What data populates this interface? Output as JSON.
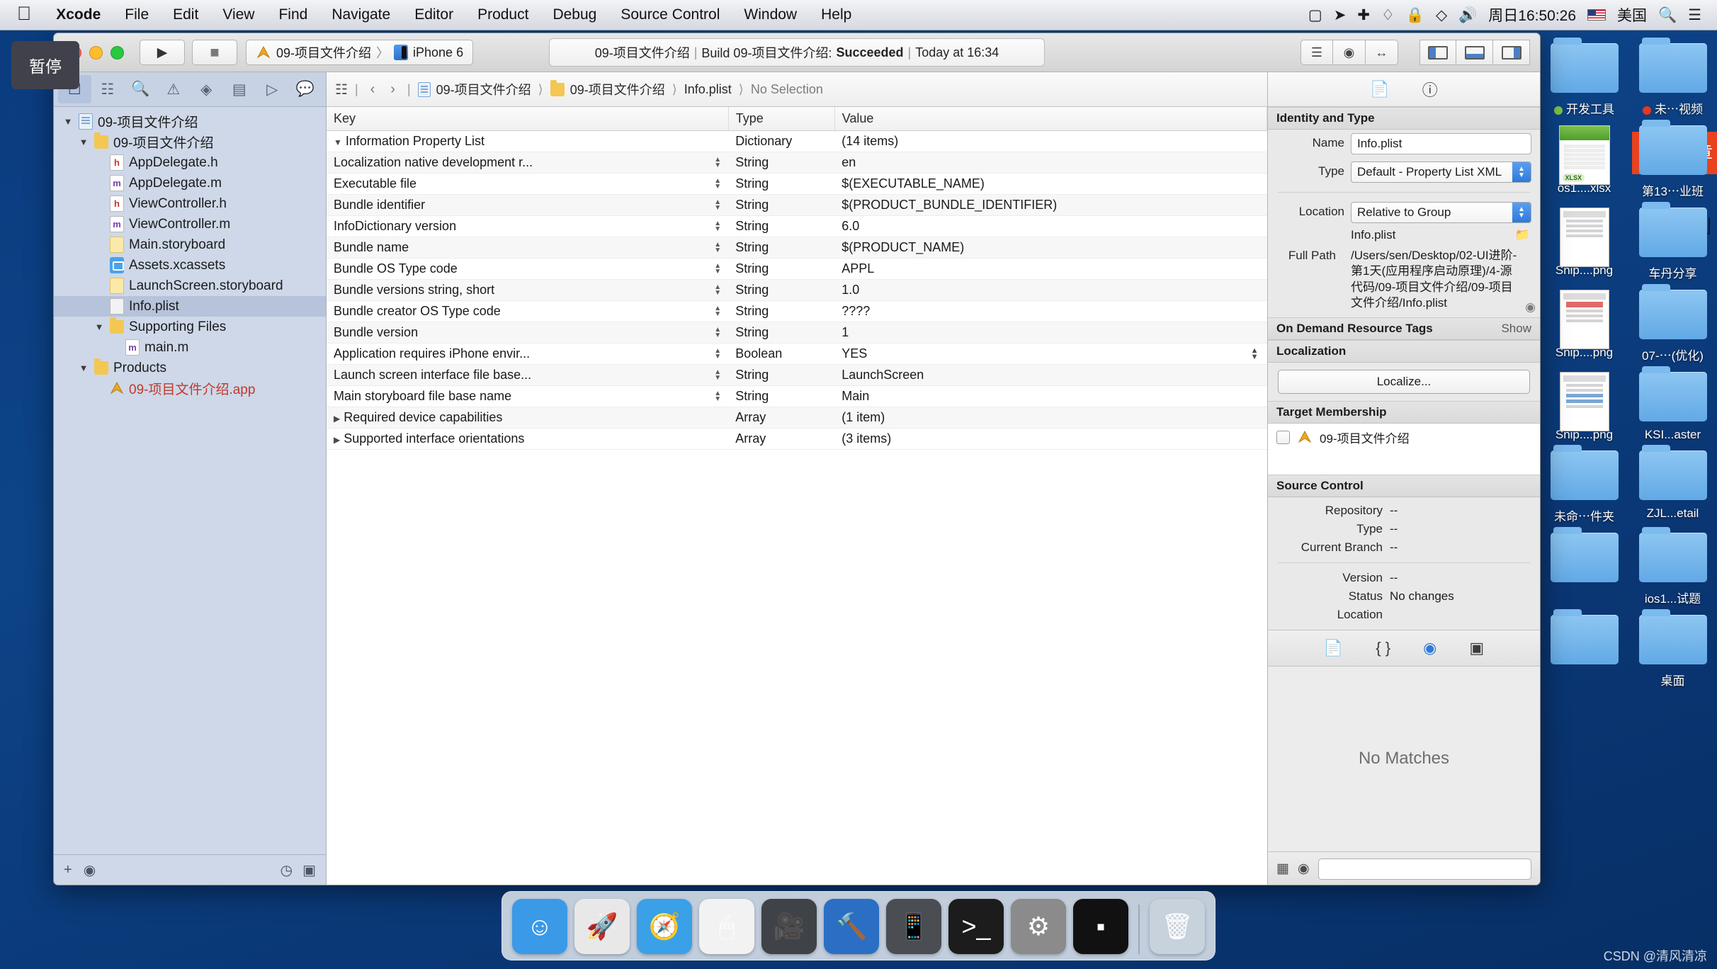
{
  "menubar": {
    "apple_icon": "apple-icon",
    "items": [
      "Xcode",
      "File",
      "Edit",
      "View",
      "Find",
      "Navigate",
      "Editor",
      "Product",
      "Debug",
      "Source Control",
      "Window",
      "Help"
    ],
    "status_icons": [
      "screen-record-icon",
      "location-arrow-icon",
      "airplay-icon",
      "bluetooth-icon",
      "lock-icon",
      "dropbox-icon",
      "volume-icon"
    ],
    "clock": "周日16:50:26",
    "input_source": "美国",
    "search_icon": "search-icon",
    "control_center_icon": "list-icon"
  },
  "tooltip": {
    "label": "暂停"
  },
  "toolbar": {
    "run_icon": "play-icon",
    "stop_icon": "stop-icon",
    "scheme_project": "09-项目文件介绍",
    "scheme_separator": "〉",
    "scheme_device": "iPhone 6",
    "status": {
      "project": "09-项目文件介绍",
      "sep1": "|",
      "build_label": "Build 09-项目文件介绍:",
      "result": "Succeeded",
      "sep2": "|",
      "time": "Today at 16:34"
    },
    "editor_segments": [
      "standard-editor-icon",
      "assistant-editor-icon",
      "version-editor-icon"
    ],
    "panel_toggles": [
      "navigator-toggle-icon",
      "debug-area-toggle-icon",
      "utilities-toggle-icon"
    ]
  },
  "navigator": {
    "tabs": [
      "folder-icon",
      "source-control-icon",
      "search-icon",
      "warning-icon",
      "breakpoint-icon",
      "test-icon",
      "debug-icon",
      "report-icon"
    ],
    "tree": [
      {
        "label": "09-项目文件介绍",
        "icon": "project-icon",
        "indent": 0,
        "twisty": "▼",
        "selected": false,
        "color": "#1b1b1b"
      },
      {
        "label": "09-项目文件介绍",
        "icon": "folder-icon",
        "indent": 1,
        "twisty": "▼",
        "selected": false,
        "color": "#1b1b1b"
      },
      {
        "label": "AppDelegate.h",
        "icon": "header-file-icon",
        "indent": 2,
        "twisty": "",
        "selected": false,
        "color": "#1b1b1b"
      },
      {
        "label": "AppDelegate.m",
        "icon": "source-file-icon",
        "indent": 2,
        "twisty": "",
        "selected": false,
        "color": "#1b1b1b"
      },
      {
        "label": "ViewController.h",
        "icon": "header-file-icon",
        "indent": 2,
        "twisty": "",
        "selected": false,
        "color": "#1b1b1b"
      },
      {
        "label": "ViewController.m",
        "icon": "source-file-icon",
        "indent": 2,
        "twisty": "",
        "selected": false,
        "color": "#1b1b1b"
      },
      {
        "label": "Main.storyboard",
        "icon": "storyboard-icon",
        "indent": 2,
        "twisty": "",
        "selected": false,
        "color": "#1b1b1b"
      },
      {
        "label": "Assets.xcassets",
        "icon": "assets-icon",
        "indent": 2,
        "twisty": "",
        "selected": false,
        "color": "#1b1b1b"
      },
      {
        "label": "LaunchScreen.storyboard",
        "icon": "storyboard-icon",
        "indent": 2,
        "twisty": "",
        "selected": false,
        "color": "#1b1b1b"
      },
      {
        "label": "Info.plist",
        "icon": "plist-icon",
        "indent": 2,
        "twisty": "",
        "selected": true,
        "color": "#1b1b1b"
      },
      {
        "label": "Supporting Files",
        "icon": "folder-icon",
        "indent": 2,
        "twisty": "▼",
        "selected": false,
        "color": "#1b1b1b"
      },
      {
        "label": "main.m",
        "icon": "source-file-icon",
        "indent": 3,
        "twisty": "",
        "selected": false,
        "color": "#1b1b1b"
      },
      {
        "label": "Products",
        "icon": "folder-icon",
        "indent": 1,
        "twisty": "▼",
        "selected": false,
        "color": "#1b1b1b"
      },
      {
        "label": "09-项目文件介绍.app",
        "icon": "app-product-icon",
        "indent": 2,
        "twisty": "",
        "selected": false,
        "color": "#c0392b"
      }
    ],
    "footer": {
      "add_icon": "plus-icon",
      "filter_icon": "filter-icon",
      "recent_icon": "clock-icon",
      "unsaved_icon": "source-control-icon"
    }
  },
  "jumpbar": {
    "grid_icon": "related-items-icon",
    "back_icon": "chevron-left-icon",
    "forward_icon": "chevron-right-icon",
    "crumbs": [
      "09-项目文件介绍",
      "09-项目文件介绍",
      "Info.plist"
    ],
    "selection": "No Selection"
  },
  "plist": {
    "columns": [
      "Key",
      "Type",
      "Value"
    ],
    "rows": [
      {
        "key": "Information Property List",
        "type": "Dictionary",
        "value": "(14 items)",
        "indent": 0,
        "twisty": "▼",
        "stepper": false,
        "dim_value": true
      },
      {
        "key": "Localization native development r...",
        "type": "String",
        "value": "en",
        "indent": 1,
        "twisty": "",
        "stepper": true,
        "dim_value": false
      },
      {
        "key": "Executable file",
        "type": "String",
        "value": "$(EXECUTABLE_NAME)",
        "indent": 1,
        "twisty": "",
        "stepper": true,
        "dim_value": false
      },
      {
        "key": "Bundle identifier",
        "type": "String",
        "value": "$(PRODUCT_BUNDLE_IDENTIFIER)",
        "indent": 1,
        "twisty": "",
        "stepper": true,
        "dim_value": false
      },
      {
        "key": "InfoDictionary version",
        "type": "String",
        "value": "6.0",
        "indent": 1,
        "twisty": "",
        "stepper": true,
        "dim_value": false
      },
      {
        "key": "Bundle name",
        "type": "String",
        "value": "$(PRODUCT_NAME)",
        "indent": 1,
        "twisty": "",
        "stepper": true,
        "dim_value": false
      },
      {
        "key": "Bundle OS Type code",
        "type": "String",
        "value": "APPL",
        "indent": 1,
        "twisty": "",
        "stepper": true,
        "dim_value": false
      },
      {
        "key": "Bundle versions string, short",
        "type": "String",
        "value": "1.0",
        "indent": 1,
        "twisty": "",
        "stepper": true,
        "dim_value": false
      },
      {
        "key": "Bundle creator OS Type code",
        "type": "String",
        "value": "????",
        "indent": 1,
        "twisty": "",
        "stepper": true,
        "dim_value": false
      },
      {
        "key": "Bundle version",
        "type": "String",
        "value": "1",
        "indent": 1,
        "twisty": "",
        "stepper": true,
        "dim_value": false
      },
      {
        "key": "Application requires iPhone envir...",
        "type": "Boolean",
        "value": "YES",
        "indent": 1,
        "twisty": "",
        "stepper": true,
        "dim_value": false
      },
      {
        "key": "Launch screen interface file base...",
        "type": "String",
        "value": "LaunchScreen",
        "indent": 1,
        "twisty": "",
        "stepper": true,
        "dim_value": false
      },
      {
        "key": "Main storyboard file base name",
        "type": "String",
        "value": "Main",
        "indent": 1,
        "twisty": "",
        "stepper": true,
        "dim_value": false
      },
      {
        "key": "Required device capabilities",
        "type": "Array",
        "value": "(1 item)",
        "indent": 1,
        "twisty": "▶",
        "stepper": false,
        "dim_value": false
      },
      {
        "key": "Supported interface orientations",
        "type": "Array",
        "value": "(3 items)",
        "indent": 1,
        "twisty": "▶",
        "stepper": false,
        "dim_value": false
      }
    ]
  },
  "inspector": {
    "top_icons": [
      "file-inspector-icon",
      "quick-help-icon"
    ],
    "identity": {
      "title": "Identity and Type",
      "name_label": "Name",
      "name_value": "Info.plist",
      "type_label": "Type",
      "type_value": "Default - Property List XML",
      "location_label": "Location",
      "location_value": "Relative to Group",
      "location_file": "Info.plist",
      "folder_icon": "folder-icon",
      "fullpath_label": "Full Path",
      "fullpath_value": "/Users/sen/Desktop/02-UI进阶-第1天(应用程序启动原理)/4-源代码/09-项目文件介绍/09-项目文件介绍/Info.plist",
      "reveal_icon": "reveal-in-finder-icon"
    },
    "on_demand": {
      "title": "On Demand Resource Tags",
      "show": "Show"
    },
    "localization": {
      "title": "Localization",
      "button": "Localize..."
    },
    "target_membership": {
      "title": "Target Membership",
      "target_name": "09-项目文件介绍",
      "target_icon": "app-product-icon",
      "checked": false
    },
    "source_control": {
      "title": "Source Control",
      "rows": [
        {
          "label": "Repository",
          "value": "--"
        },
        {
          "label": "Type",
          "value": "--"
        },
        {
          "label": "Current Branch",
          "value": "--"
        }
      ],
      "rows2": [
        {
          "label": "Version",
          "value": "--"
        },
        {
          "label": "Status",
          "value": "No changes"
        },
        {
          "label": "Location",
          "value": ""
        }
      ]
    },
    "library_tabs": [
      "file-template-library-icon",
      "code-snippet-library-icon",
      "object-library-icon",
      "media-library-icon"
    ],
    "library_empty": "No Matches",
    "footer": {
      "grid_icon": "grid-icon",
      "filter_icon": "filter-icon",
      "search_placeholder": ""
    }
  },
  "desktop": {
    "icons": [
      {
        "label": "开发工具",
        "type": "folder",
        "tag": "#7dc242"
      },
      {
        "label": "未⋯视频",
        "type": "folder",
        "tag": "#e8371f"
      },
      {
        "label": "os1....xlsx",
        "type": "xlsx",
        "tag": ""
      },
      {
        "label": "第13⋯业班",
        "type": "folder",
        "tag": ""
      },
      {
        "label": "Snip....png",
        "type": "screenshot",
        "tag": ""
      },
      {
        "label": "车丹分享",
        "type": "folder",
        "tag": ""
      },
      {
        "label": "Snip....png",
        "type": "screenshot2",
        "tag": ""
      },
      {
        "label": "07-⋯(优化)",
        "type": "folder",
        "tag": ""
      },
      {
        "label": "Snip....png",
        "type": "screenshot3",
        "tag": ""
      },
      {
        "label": "KSI...aster",
        "type": "folder",
        "tag": ""
      },
      {
        "label": "未命⋯件夹",
        "type": "folder",
        "tag": ""
      },
      {
        "label": "ZJL...etail",
        "type": "folder",
        "tag": ""
      },
      {
        "label": "",
        "type": "folder",
        "tag": ""
      },
      {
        "label": "ios1...试题",
        "type": "folder",
        "tag": ""
      },
      {
        "label": "",
        "type": "folder",
        "tag": ""
      },
      {
        "label": "桌面",
        "type": "folder",
        "tag": ""
      }
    ]
  },
  "dock": {
    "items": [
      {
        "name": "finder-icon",
        "glyph": "☺",
        "color": "#3a9ae8"
      },
      {
        "name": "launchpad-icon",
        "glyph": "🚀",
        "color": "#e8e8e8"
      },
      {
        "name": "safari-icon",
        "glyph": "🧭",
        "color": "#3aa0e8"
      },
      {
        "name": "mouse-icon",
        "glyph": "🖱",
        "color": "#f2f2f2"
      },
      {
        "name": "quicktime-icon",
        "glyph": "🎥",
        "color": "#3f4247"
      },
      {
        "name": "xcode-icon",
        "glyph": "🔨",
        "color": "#2b6fc4"
      },
      {
        "name": "simulator-icon",
        "glyph": "📱",
        "color": "#4a4d52"
      },
      {
        "name": "terminal-icon",
        "glyph": ">_",
        "color": "#1c1c1c"
      },
      {
        "name": "system-preferences-icon",
        "glyph": "⚙",
        "color": "#8b8b8b"
      },
      {
        "name": "iterm-icon",
        "glyph": "▪",
        "color": "#111111"
      },
      {
        "name": "trash-icon",
        "glyph": "🗑",
        "color": "#c8d2dc"
      }
    ]
  },
  "watermark": "CSDN @清风清凉"
}
